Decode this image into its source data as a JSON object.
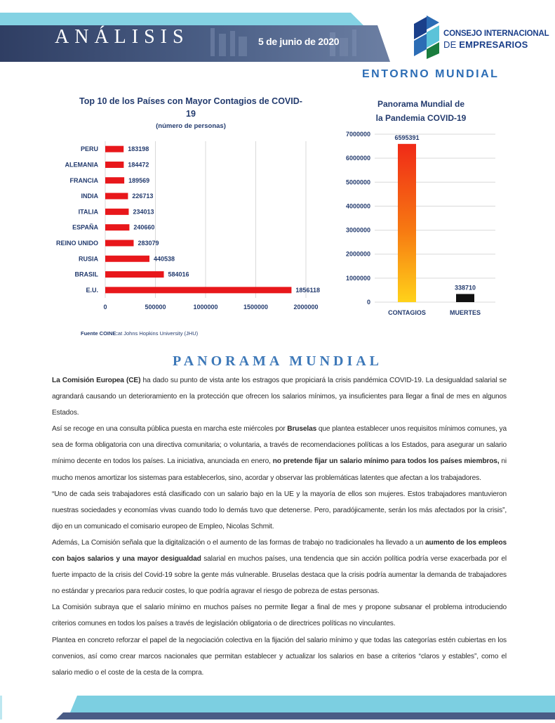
{
  "header": {
    "title": "ANÁLISIS",
    "date": "5 de junio de 2020",
    "logo_line1": "CONSEJO INTERNACIONAL",
    "logo_line2_prefix": "DE ",
    "logo_line2_bold": "EMPRESARIOS",
    "section_label": "ENTORNO MUNDIAL"
  },
  "colors": {
    "accent": "#2c6db5",
    "bar_red": "#e8171b",
    "header_dark": "#3a4a6e",
    "teal": "#5bc3d9"
  },
  "chart_data": [
    {
      "type": "bar",
      "orientation": "horizontal",
      "title": "Top 10 de los Países con Mayor Contagios de COVID-19",
      "subtitle": "(número de personas)",
      "categories": [
        "PERU",
        "ALEMANIA",
        "FRANCIA",
        "INDIA",
        "ITALIA",
        "ESPAÑA",
        "REINO UNIDO",
        "RUSIA",
        "BRASIL",
        "E.U."
      ],
      "values": [
        183198,
        184472,
        189569,
        226713,
        234013,
        240660,
        283079,
        440538,
        584016,
        1856118
      ],
      "xlim": [
        0,
        2000000
      ],
      "xticks": [
        "0",
        "500000",
        "1000000",
        "1500000",
        "2000000"
      ],
      "grid": true
    },
    {
      "type": "bar",
      "title": "Panorama Mundial de la Pandemia COVID-19",
      "categories": [
        "CONTAGIOS",
        "MUERTES"
      ],
      "values": [
        6595391,
        338710
      ],
      "ylim": [
        0,
        7000000
      ],
      "yticks": [
        "0",
        "1000000",
        "2000000",
        "3000000",
        "4000000",
        "5000000",
        "6000000",
        "7000000"
      ],
      "grid": true
    }
  ],
  "source": {
    "bold": "Fuente COINE:",
    "rest": "at Johns Hopkins University (JHU)"
  },
  "section_title": "PANORAMA MUNDIAL",
  "paragraphs": {
    "p1_bold": "La Comisión Europea (CE)",
    "p1_rest": " ha dado su punto de vista ante los estragos que propiciará la crisis pandémica COVID-19. La desigualdad salarial se agrandará causando un deterioramiento en la protección que ofrecen los salarios mínimos, ya insuficientes para llegar a final de mes en algunos Estados.",
    "p2_a": "Así se recoge en una consulta pública puesta en marcha este miércoles por ",
    "p2_bold1": "Bruselas",
    "p2_b": " que plantea establecer unos requisitos mínimos comunes, ya sea de forma obligatoria con una directiva comunitaria; o voluntaria, a través de recomendaciones políticas a los Estados, para asegurar un salario mínimo decente en todos los países. La iniciativa, anunciada en enero, ",
    "p2_bold2": "no pretende fijar un salario mínimo para todos los países miembros,",
    "p2_c": " ni mucho menos amortizar los sistemas para establecerlos, sino, acordar y observar las problemáticas latentes que afectan a los trabajadores.",
    "p3": "“Uno de cada seis trabajadores está clasificado con un salario bajo en la UE y la mayoría de ellos son mujeres. Estos trabajadores mantuvieron nuestras sociedades y economías vivas cuando todo lo demás tuvo que detenerse. Pero, paradójicamente, serán los más afectados por la crisis”, dijo en un comunicado el comisario europeo de Empleo, Nicolas Schmit.",
    "p4_a": "Además, La Comisión señala que la digitalización o el aumento de las formas de trabajo no tradicionales ha llevado a un ",
    "p4_bold": "aumento de los empleos con bajos salarios y una mayor desigualdad",
    "p4_b": " salarial en muchos países, una tendencia que sin acción política podría verse exacerbada por el fuerte impacto de la crisis del Covid-19 sobre la gente más vulnerable. Bruselas destaca que la crisis podría aumentar la demanda de trabajadores no estándar y precarios para reducir costes, lo que podría agravar el riesgo de pobreza de estas personas.",
    "p5": "La Comisión subraya que el salario mínimo en muchos países no permite llegar a final de mes y propone subsanar el problema introduciendo criterios comunes en todos los países a través de legislación obligatoria o de directrices políticas no vinculantes.",
    "p6": "Plantea en concreto reforzar el papel de la negociación colectiva en la fijación del salario mínimo y que todas las categorías estén cubiertas en los convenios, así como crear marcos nacionales que permitan establecer y actualizar los salarios en base a criterios “claros y estables”, como el salario medio o el coste de la cesta de la compra."
  }
}
